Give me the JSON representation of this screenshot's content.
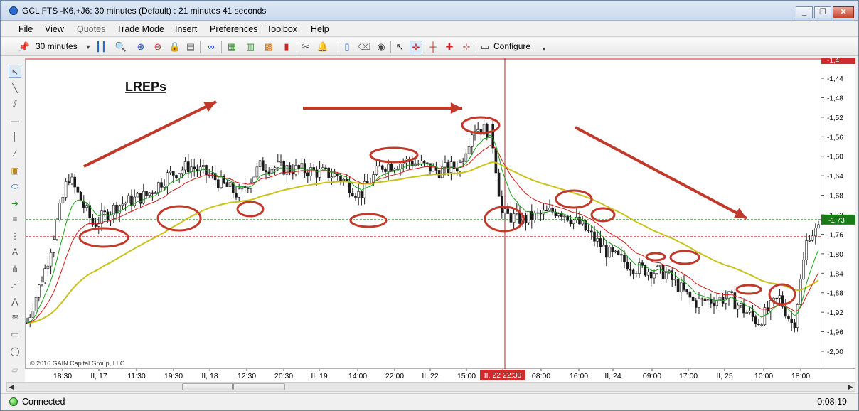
{
  "window": {
    "title": "GCL FTS -K6,+J6: 30 minutes (Default) : 21 minutes 41 seconds",
    "controls": {
      "minimize": "_",
      "restore": "❐",
      "close": "✕"
    }
  },
  "menu": [
    "File",
    "View",
    "Quotes",
    "Trade Mode",
    "Insert",
    "Preferences",
    "Toolbox",
    "Help"
  ],
  "menu_disabled": [
    "Quotes"
  ],
  "toolbar": {
    "timeframe": "30 minutes",
    "configure_label": "Configure"
  },
  "chart": {
    "annotation_label": "LREPs",
    "copyright": "© 2016 GAIN Capital Group, LLC",
    "price_labels": [
      "-1,44",
      "-1,48",
      "-1,52",
      "-1,56",
      "-1,60",
      "-1,64",
      "-1,68",
      "-1,72",
      "-1,76",
      "-1,80",
      "-1,84",
      "-1,88",
      "-1,92",
      "-1,96",
      "-2,00"
    ],
    "current_price": "-1,73",
    "top_price_tag": "-1,4",
    "time_labels": [
      "18:30",
      "II, 17",
      "11:30",
      "19:30",
      "II, 18",
      "12:30",
      "20:30",
      "II, 19",
      "14:00",
      "22:00",
      "II, 22",
      "15:00",
      "II, 22 22:30",
      "08:00",
      "16:00",
      "II, 24",
      "09:00",
      "17:00",
      "II, 25",
      "10:00",
      "18:00"
    ],
    "crosshair_time": "II, 22 22:30",
    "colors": {
      "candle": "#1a1a1a",
      "ema_fast": "#1aa21a",
      "ema_mid": "#d21a1a",
      "ema_slow": "#c8c21a",
      "annotation": "#c0392b",
      "hline_green": "#1a8a1a",
      "hline_red": "#cc2222"
    }
  },
  "status": {
    "connection": "Connected",
    "clock": "0:08:19"
  }
}
